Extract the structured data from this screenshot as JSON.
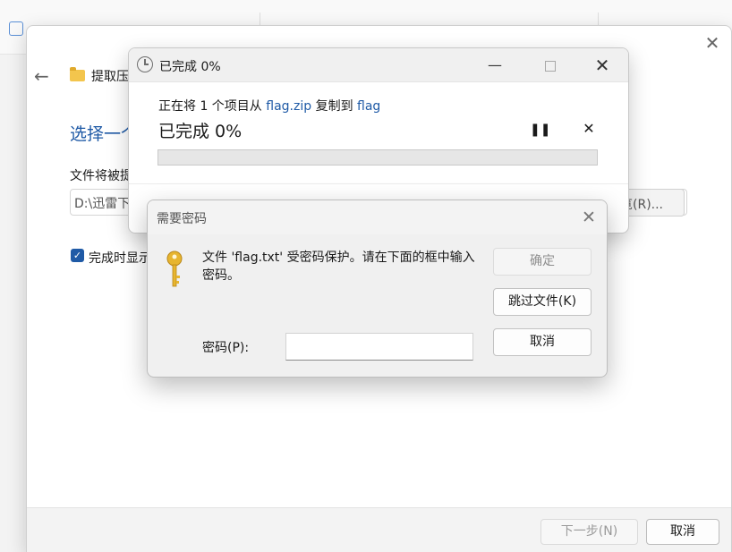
{
  "wizard": {
    "title": "提取压",
    "heading": "选择一个",
    "dest_label": "文件将被提",
    "path_value": "D:\\迅雷下",
    "browse_label": "览(R)...",
    "show_files_label": "完成时显示",
    "show_files_checked": true,
    "next_label": "下一步(N)",
    "cancel_label": "取消"
  },
  "progress": {
    "title": "已完成 0%",
    "desc_prefix": "正在将 1 个项目从 ",
    "source": "flag.zip",
    "desc_mid": " 复制到 ",
    "dest": "flag",
    "percent_text": "已完成 0%",
    "percent_value": 0
  },
  "password": {
    "title": "需要密码",
    "message": "文件 'flag.txt' 受密码保护。请在下面的框中输入密码。",
    "field_label": "密码(P):",
    "field_value": "",
    "ok_label": "确定",
    "skip_label": "跳过文件(K)",
    "cancel_label": "取消"
  },
  "colors": {
    "accent": "#1f5aa6",
    "progress_fill": "#26a53c",
    "key": "#e7b52f"
  }
}
